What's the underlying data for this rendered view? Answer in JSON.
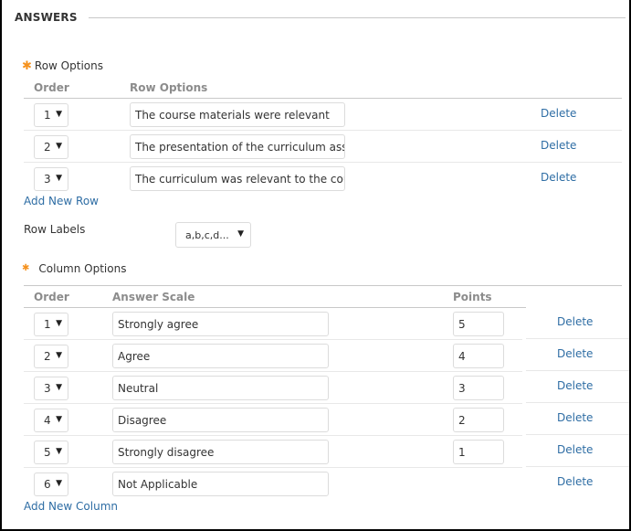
{
  "section": {
    "title": "ANSWERS"
  },
  "row_options": {
    "label": "Row Options",
    "required_icon": "asterisk-icon",
    "headers": {
      "order": "Order",
      "text": "Row Options"
    },
    "rows": [
      {
        "order": "1",
        "text": "The course materials were relevant",
        "delete": "Delete"
      },
      {
        "order": "2",
        "text": "The presentation of the curriculum assis",
        "delete": "Delete"
      },
      {
        "order": "3",
        "text": "The curriculum was relevant to the cour",
        "delete": "Delete"
      }
    ],
    "add_label": "Add New Row"
  },
  "row_labels": {
    "label": "Row Labels",
    "selected": "a,b,c,d..."
  },
  "column_options": {
    "label": "Column Options",
    "required_icon": "asterisk-icon",
    "headers": {
      "order": "Order",
      "text": "Answer Scale",
      "points": "Points"
    },
    "rows": [
      {
        "order": "1",
        "text": "Strongly agree",
        "points": "5",
        "delete": "Delete"
      },
      {
        "order": "2",
        "text": "Agree",
        "points": "4",
        "delete": "Delete"
      },
      {
        "order": "3",
        "text": "Neutral",
        "points": "3",
        "delete": "Delete"
      },
      {
        "order": "4",
        "text": "Disagree",
        "points": "2",
        "delete": "Delete"
      },
      {
        "order": "5",
        "text": "Strongly disagree",
        "points": "1",
        "delete": "Delete"
      },
      {
        "order": "6",
        "text": "Not Applicable",
        "points": null,
        "delete": "Delete"
      }
    ],
    "add_label": "Add New Column"
  },
  "colors": {
    "accent_star": "#f5921e",
    "link": "#2e6da4",
    "header_text": "#8c8c8c"
  }
}
